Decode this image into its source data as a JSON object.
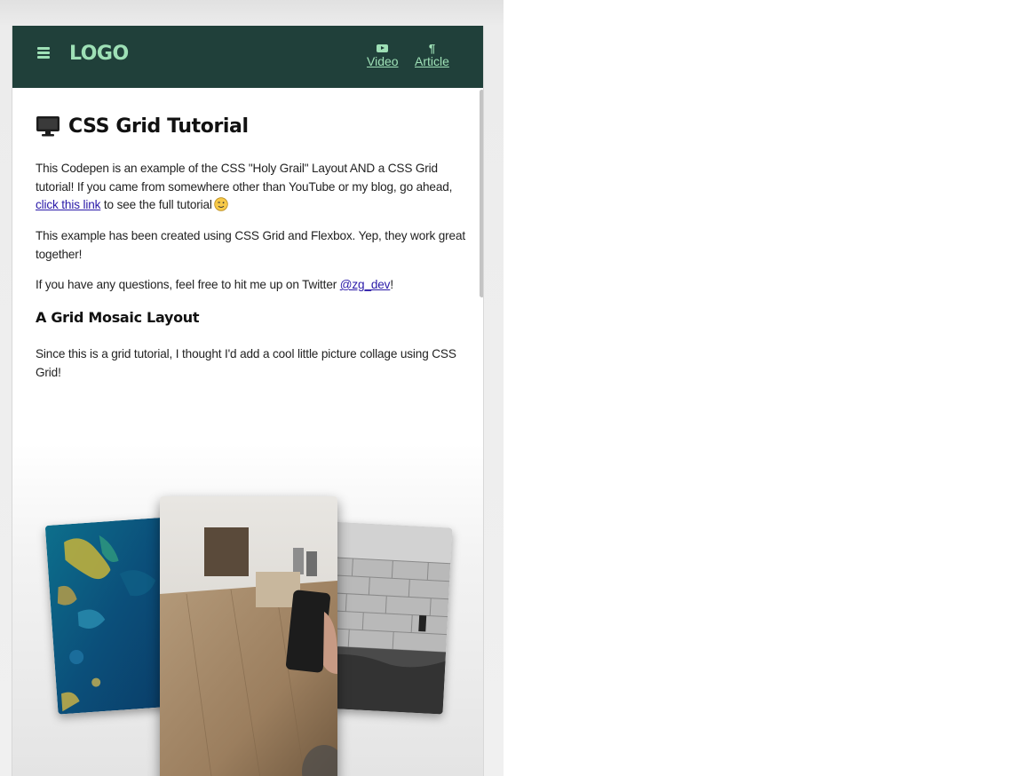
{
  "navbar": {
    "logo": "LOGO",
    "links": [
      {
        "label": "Video",
        "icon": "youtube-icon"
      },
      {
        "label": "Article",
        "icon": "pilcrow-icon"
      }
    ],
    "menu_icon": "hamburger-icon"
  },
  "main": {
    "title": "CSS Grid Tutorial",
    "title_icon": "monitor-icon",
    "intro": {
      "text_before": "This Codepen is an example of the CSS \"Holy Grail\" Layout AND a CSS Grid tutorial! If you came from somewhere other than YouTube or my blog, go ahead, ",
      "link": "click this link",
      "text_after": " to see the full tutorial"
    },
    "para2": "This example has been created using CSS Grid and Flexbox. Yep, they work great together!",
    "para3": {
      "text_before": "If you have any questions, feel free to hit me up on Twitter ",
      "link": "@zg_dev",
      "text_after": "!"
    },
    "section_heading": "A Grid Mosaic Layout",
    "section_text": "Since this is a grid tutorial, I thought I'd add a cool little picture collage using CSS Grid!"
  },
  "mosaic": {
    "images": [
      "ocean-aerial-photo",
      "table-phone-photo",
      "stone-wall-photo"
    ]
  },
  "colors": {
    "navbar_bg": "#20403a",
    "accent": "#9ee0b6",
    "link": "#2a1aa8"
  }
}
